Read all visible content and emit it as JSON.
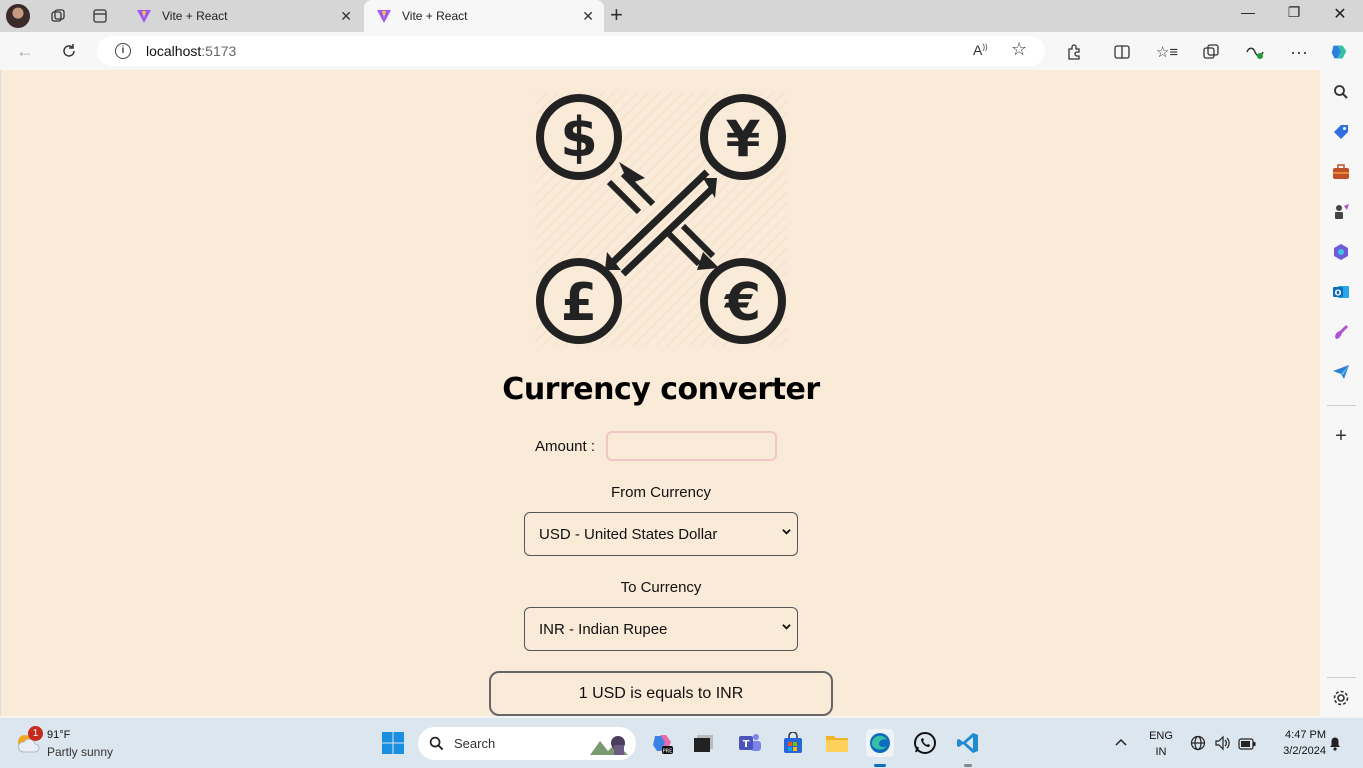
{
  "browser": {
    "tabs": [
      {
        "label": "Vite + React"
      },
      {
        "label": "Vite + React"
      }
    ],
    "address": {
      "host": "localhost",
      "port": ":5173"
    }
  },
  "app": {
    "title": "Currency converter",
    "amount_label": "Amount :",
    "amount_value": "",
    "from_label": "From Currency",
    "from_selected": "USD - United States Dollar",
    "to_label": "To Currency",
    "to_selected": "INR - Indian Rupee",
    "result_text": "1 USD is equals to INR"
  },
  "taskbar": {
    "weather": {
      "temp": "91°F",
      "desc": "Partly sunny",
      "badge": "1"
    },
    "search_label": "Search",
    "lang_line1": "ENG",
    "lang_line2": "IN",
    "time": "4:47 PM",
    "date": "3/2/2024"
  },
  "colors": {
    "page_bg": "#faead8",
    "accent_edge": "#0f6cbd"
  }
}
